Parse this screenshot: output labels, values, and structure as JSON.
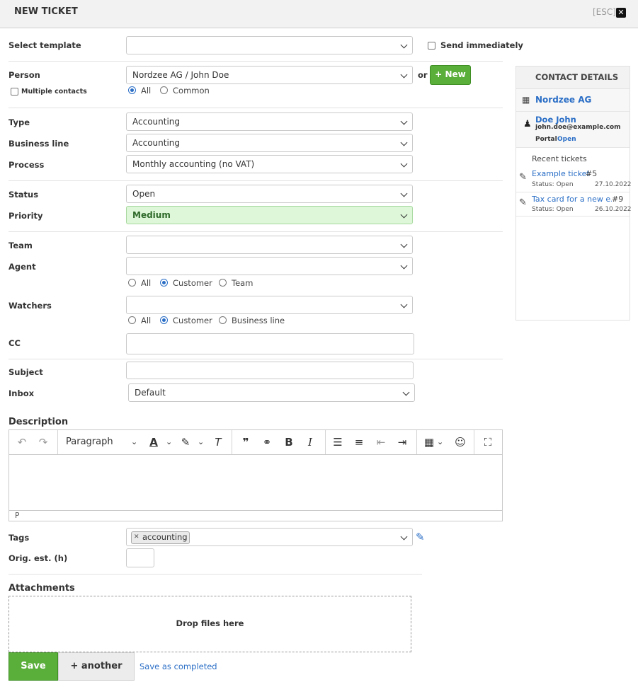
{
  "header": {
    "title": "NEW TICKET",
    "esc": "[ESC]",
    "close_glyph": "✕"
  },
  "form": {
    "select_template_label": "Select template",
    "send_immediately_label": "Send immediately",
    "person_label": "Person",
    "person_value": "Nordzee AG / John Doe",
    "or_label": "or",
    "new_button": "+ New",
    "multiple_contacts_label": "Multiple contacts",
    "person_scope_options": [
      "All",
      "Common"
    ],
    "type_label": "Type",
    "type_value": "Accounting",
    "business_line_label": "Business line",
    "business_line_value": "Accounting",
    "process_label": "Process",
    "process_value": "Monthly accounting (no VAT)",
    "status_label": "Status",
    "status_value": "Open",
    "priority_label": "Priority",
    "priority_value": "Medium",
    "team_label": "Team",
    "agent_label": "Agent",
    "agent_scope_options": [
      "All",
      "Customer",
      "Team"
    ],
    "watchers_label": "Watchers",
    "watchers_scope_options": [
      "All",
      "Customer",
      "Business line"
    ],
    "cc_label": "CC",
    "subject_label": "Subject",
    "inbox_label": "Inbox",
    "inbox_value": "Default",
    "description_label": "Description",
    "paragraph_format": "Paragraph",
    "editor_status": "P",
    "tags_label": "Tags",
    "tag_value": "accounting",
    "orig_est_label": "Orig. est. (h)",
    "attachments_label": "Attachments",
    "drop_files": "Drop files here"
  },
  "actions": {
    "save": "Save",
    "another": "+ another",
    "save_completed": "Save as completed"
  },
  "contact_panel": {
    "title": "CONTACT DETAILS",
    "company": "Nordzee AG",
    "person_name": "Doe John",
    "person_email": "john.doe@example.com",
    "portal_label": "Portal",
    "portal_status": "Open",
    "recent_tickets_label": "Recent tickets",
    "recent_tickets": [
      {
        "title": "Example ticket",
        "number": "#5",
        "status": "Status: Open",
        "date": "27.10.2022"
      },
      {
        "title": "Tax card for a new e...",
        "number": "#9",
        "status": "Status: Open",
        "date": "26.10.2022"
      }
    ]
  },
  "colors": {
    "accent_green": "#5aae3a",
    "link_blue": "#2a6ec6",
    "priority_bg": "#ddf7d8"
  }
}
